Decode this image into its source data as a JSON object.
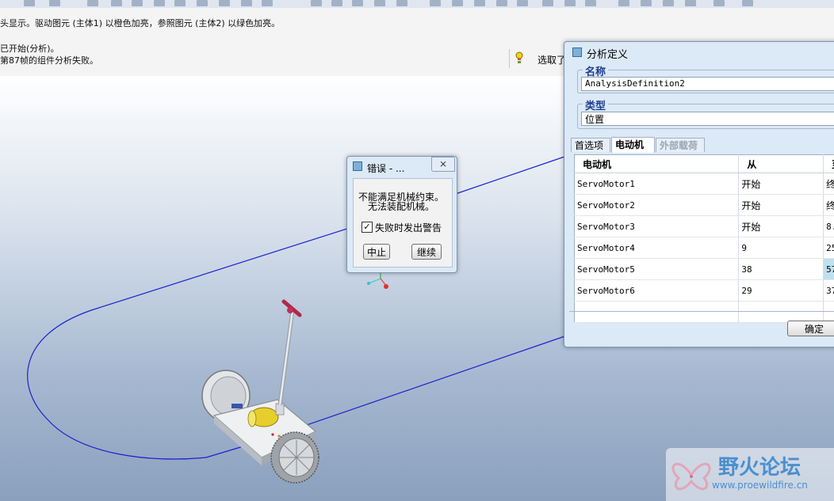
{
  "messages": {
    "line1": "头显示。驱动图元 (主体1) 以橙色加亮，参照图元 (主体2) 以绿色加亮。",
    "line2": "已开始(分析)。",
    "line3": "第87帧的组件分析失败。"
  },
  "selection": {
    "label": "选取了"
  },
  "error_dialog": {
    "title": "错误 - ...",
    "close_glyph": "⨯",
    "message_line1": "不能满足机械约束。",
    "message_line2": "无法装配机械。",
    "checkbox_label": "失败时发出警告",
    "checkbox_checked": true,
    "abort_button": "中止",
    "continue_button": "继续"
  },
  "analysis_dialog": {
    "title": "分析定义",
    "name_legend": "名称",
    "name_value": "AnalysisDefinition2",
    "type_legend": "类型",
    "type_value": "位置",
    "tabs": [
      {
        "label": "首选项",
        "state": "normal"
      },
      {
        "label": "电动机",
        "state": "active"
      },
      {
        "label": "外部载荷",
        "state": "disabled"
      }
    ],
    "columns": [
      "电动机",
      "从",
      "至"
    ],
    "rows": [
      {
        "motor": "ServoMotor1",
        "from": "开始",
        "to": "终"
      },
      {
        "motor": "ServoMotor2",
        "from": "开始",
        "to": "终"
      },
      {
        "motor": "ServoMotor3",
        "from": "开始",
        "to": "8."
      },
      {
        "motor": "ServoMotor4",
        "from": "9",
        "to": "25"
      },
      {
        "motor": "ServoMotor5",
        "from": "38",
        "to": "57"
      },
      {
        "motor": "ServoMotor6",
        "from": "29",
        "to": "37"
      }
    ],
    "ok_button": "确定"
  },
  "watermark": {
    "title": "野火论坛",
    "url": "www.proewildfire.cn"
  },
  "colors": {
    "path_line": "#1a22cc",
    "highlight_cell": "#bfe0ef",
    "legend_text": "#1f3f8f",
    "watermark_text": "#4a8fd0"
  }
}
